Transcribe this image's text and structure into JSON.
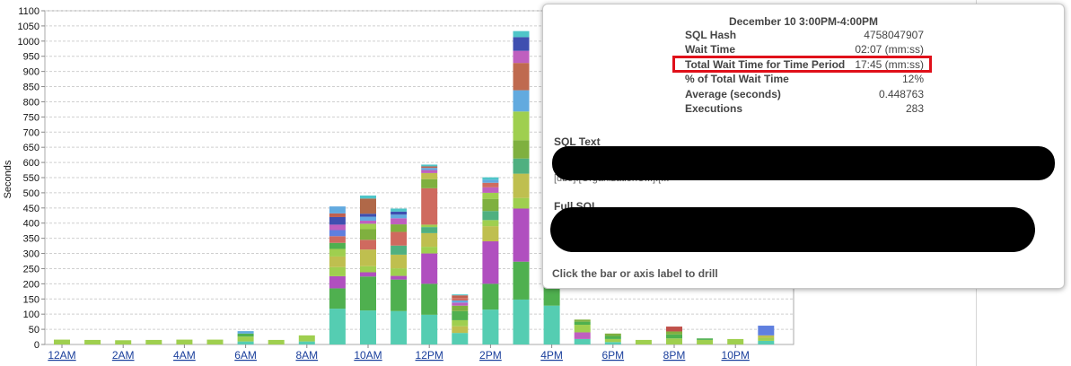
{
  "chart_data": {
    "type": "bar",
    "stacked": true,
    "ylabel": "Seconds",
    "xlabel": "",
    "ylim": [
      0,
      1100
    ],
    "ytick_values": [
      0,
      50,
      100,
      150,
      200,
      250,
      300,
      350,
      400,
      450,
      500,
      550,
      600,
      650,
      700,
      750,
      800,
      850,
      900,
      950,
      1000,
      1050,
      1100
    ],
    "grid": true,
    "categories": [
      "12AM",
      "1AM",
      "2AM",
      "3AM",
      "4AM",
      "5AM",
      "6AM",
      "7AM",
      "8AM",
      "9AM",
      "10AM",
      "11AM",
      "12PM",
      "1PM",
      "2PM",
      "3PM",
      "4PM",
      "5PM",
      "6PM",
      "7PM",
      "8PM",
      "9PM",
      "10PM",
      "11PM"
    ],
    "x_tick_labels": [
      {
        "index": 0,
        "label": "12AM"
      },
      {
        "index": 2,
        "label": "2AM"
      },
      {
        "index": 4,
        "label": "4AM"
      },
      {
        "index": 6,
        "label": "6AM"
      },
      {
        "index": 8,
        "label": "8AM"
      },
      {
        "index": 10,
        "label": "10AM"
      },
      {
        "index": 12,
        "label": "12PM"
      },
      {
        "index": 14,
        "label": "2PM"
      },
      {
        "index": 16,
        "label": "4PM"
      },
      {
        "index": 18,
        "label": "6PM"
      },
      {
        "index": 20,
        "label": "8PM"
      },
      {
        "index": 22,
        "label": "10PM"
      }
    ],
    "stacks": [
      [
        {
          "v": 16,
          "c": "#9fcf4f"
        }
      ],
      [
        {
          "v": 15,
          "c": "#9fcf4f"
        }
      ],
      [
        {
          "v": 14,
          "c": "#9fcf4f"
        }
      ],
      [
        {
          "v": 15,
          "c": "#9fcf4f"
        }
      ],
      [
        {
          "v": 16,
          "c": "#9fcf4f"
        }
      ],
      [
        {
          "v": 16,
          "c": "#9fcf4f"
        }
      ],
      [
        {
          "v": 10,
          "c": "#55cdb2"
        },
        {
          "v": 16,
          "c": "#9fcf4f"
        },
        {
          "v": 10,
          "c": "#4fb04f"
        },
        {
          "v": 8,
          "c": "#62aadf"
        }
      ],
      [
        {
          "v": 15,
          "c": "#9fcf4f"
        }
      ],
      [
        {
          "v": 10,
          "c": "#55cdb2"
        },
        {
          "v": 20,
          "c": "#9fcf4f"
        }
      ],
      [
        {
          "v": 118,
          "c": "#55cdb2"
        },
        {
          "v": 67,
          "c": "#4fb04f"
        },
        {
          "v": 40,
          "c": "#b04fbf"
        },
        {
          "v": 30,
          "c": "#9fcf4f"
        },
        {
          "v": 35,
          "c": "#bfbf4f"
        },
        {
          "v": 25,
          "c": "#9fcf4f"
        },
        {
          "v": 20,
          "c": "#4fb04f"
        },
        {
          "v": 22,
          "c": "#cf6a5f"
        },
        {
          "v": 20,
          "c": "#5f7fdf"
        },
        {
          "v": 18,
          "c": "#bf5fbf"
        },
        {
          "v": 25,
          "c": "#3f4fb0"
        },
        {
          "v": 12,
          "c": "#c06050"
        },
        {
          "v": 23,
          "c": "#62aadf"
        }
      ],
      [
        {
          "v": 112,
          "c": "#55cdb2"
        },
        {
          "v": 112,
          "c": "#4fb04f"
        },
        {
          "v": 14,
          "c": "#b04fbf"
        },
        {
          "v": 20,
          "c": "#9fcf4f"
        },
        {
          "v": 55,
          "c": "#bfbf4f"
        },
        {
          "v": 32,
          "c": "#cf6a5f"
        },
        {
          "v": 35,
          "c": "#7fb03f"
        },
        {
          "v": 18,
          "c": "#9fcf4f"
        },
        {
          "v": 10,
          "c": "#bf5fbf"
        },
        {
          "v": 13,
          "c": "#62aadf"
        },
        {
          "v": 10,
          "c": "#3f4fb0"
        },
        {
          "v": 50,
          "c": "#b06848"
        },
        {
          "v": 10,
          "c": "#4fc5c8"
        }
      ],
      [
        {
          "v": 110,
          "c": "#55cdb2"
        },
        {
          "v": 104,
          "c": "#4fb04f"
        },
        {
          "v": 12,
          "c": "#b04fbf"
        },
        {
          "v": 25,
          "c": "#9fcf4f"
        },
        {
          "v": 45,
          "c": "#bfbf4f"
        },
        {
          "v": 30,
          "c": "#4fb080"
        },
        {
          "v": 45,
          "c": "#cf6a5f"
        },
        {
          "v": 25,
          "c": "#7fb03f"
        },
        {
          "v": 20,
          "c": "#bf5fbf"
        },
        {
          "v": 12,
          "c": "#62aadf"
        },
        {
          "v": 10,
          "c": "#3f4fb0"
        },
        {
          "v": 10,
          "c": "#4fc5c8"
        }
      ],
      [
        {
          "v": 98,
          "c": "#55cdb2"
        },
        {
          "v": 102,
          "c": "#4fb04f"
        },
        {
          "v": 100,
          "c": "#b04fbf"
        },
        {
          "v": 22,
          "c": "#9fcf4f"
        },
        {
          "v": 45,
          "c": "#bfbf4f"
        },
        {
          "v": 20,
          "c": "#4fb080"
        },
        {
          "v": 8,
          "c": "#9fcf4f"
        },
        {
          "v": 120,
          "c": "#cf6a5f"
        },
        {
          "v": 30,
          "c": "#7fb03f"
        },
        {
          "v": 20,
          "c": "#bfbf4f"
        },
        {
          "v": 10,
          "c": "#bf5fbf"
        },
        {
          "v": 7,
          "c": "#62aadf"
        },
        {
          "v": 5,
          "c": "#c06050"
        },
        {
          "v": 6,
          "c": "#4fc5c8"
        }
      ],
      [
        {
          "v": 38,
          "c": "#55cdb2"
        },
        {
          "v": 22,
          "c": "#bfbf4f"
        },
        {
          "v": 20,
          "c": "#9fcf4f"
        },
        {
          "v": 30,
          "c": "#4fb04f"
        },
        {
          "v": 18,
          "c": "#7fb03f"
        },
        {
          "v": 10,
          "c": "#bf5fbf"
        },
        {
          "v": 7,
          "c": "#62aadf"
        },
        {
          "v": 8,
          "c": "#cf6a5f"
        },
        {
          "v": 9,
          "c": "#c06050"
        },
        {
          "v": 3,
          "c": "#4fc5c8"
        }
      ],
      [
        {
          "v": 115,
          "c": "#55cdb2"
        },
        {
          "v": 85,
          "c": "#4fb04f"
        },
        {
          "v": 140,
          "c": "#b04fbf"
        },
        {
          "v": 50,
          "c": "#bfbf4f"
        },
        {
          "v": 20,
          "c": "#9fcf4f"
        },
        {
          "v": 30,
          "c": "#4fb080"
        },
        {
          "v": 40,
          "c": "#7fb03f"
        },
        {
          "v": 20,
          "c": "#9fcf4f"
        },
        {
          "v": 18,
          "c": "#bf5fbf"
        },
        {
          "v": 15,
          "c": "#cf6a5f"
        },
        {
          "v": 10,
          "c": "#62aadf"
        },
        {
          "v": 8,
          "c": "#4fc5c8"
        }
      ],
      [
        {
          "v": 148,
          "c": "#55cdb2"
        },
        {
          "v": 125,
          "c": "#4fb04f"
        },
        {
          "v": 175,
          "c": "#b04fbf"
        },
        {
          "v": 35,
          "c": "#9fcf4f"
        },
        {
          "v": 80,
          "c": "#bfbf4f"
        },
        {
          "v": 50,
          "c": "#4fb080"
        },
        {
          "v": 60,
          "c": "#7fb03f"
        },
        {
          "v": 95,
          "c": "#9fcf4f"
        },
        {
          "v": 70,
          "c": "#62aadf"
        },
        {
          "v": 90,
          "c": "#bf6a4f"
        },
        {
          "v": 40,
          "c": "#bf5fbf"
        },
        {
          "v": 45,
          "c": "#3f4fb0"
        },
        {
          "v": 20,
          "c": "#4fc5c8"
        }
      ],
      [
        {
          "v": 128,
          "c": "#55cdb2"
        },
        {
          "v": 80,
          "c": "#4fb04f"
        }
      ],
      [
        {
          "v": 18,
          "c": "#55cdb2"
        },
        {
          "v": 22,
          "c": "#bf5fbf"
        },
        {
          "v": 25,
          "c": "#9fcf4f"
        },
        {
          "v": 10,
          "c": "#4fb04f"
        },
        {
          "v": 7,
          "c": "#7fb03f"
        }
      ],
      [
        {
          "v": 8,
          "c": "#55cdb2"
        },
        {
          "v": 10,
          "c": "#9fcf4f"
        },
        {
          "v": 10,
          "c": "#4fb04f"
        },
        {
          "v": 8,
          "c": "#7fb03f"
        }
      ],
      [
        {
          "v": 15,
          "c": "#9fcf4f"
        }
      ],
      [
        {
          "v": 20,
          "c": "#9fcf4f"
        },
        {
          "v": 13,
          "c": "#4fb04f"
        },
        {
          "v": 10,
          "c": "#7fb03f"
        },
        {
          "v": 16,
          "c": "#c0504a"
        }
      ],
      [
        {
          "v": 15,
          "c": "#9fcf4f"
        },
        {
          "v": 5,
          "c": "#4fb04f"
        }
      ],
      [
        {
          "v": 18,
          "c": "#9fcf4f"
        }
      ],
      [
        {
          "v": 12,
          "c": "#55cdb2"
        },
        {
          "v": 10,
          "c": "#9fcf4f"
        },
        {
          "v": 8,
          "c": "#bfbf4f"
        },
        {
          "v": 32,
          "c": "#5f7fdf"
        }
      ]
    ]
  },
  "tooltip": {
    "title": "December 10 3:00PM-4:00PM",
    "rows": [
      {
        "label": "SQL Hash",
        "value": "4758047907"
      },
      {
        "label": "Wait Time",
        "value": "02:07 (mm:ss)"
      },
      {
        "label": "Total Wait Time for Time Period",
        "value": "17:45 (mm:ss)"
      },
      {
        "label": "% of Total Wait Time",
        "value": "12%"
      },
      {
        "label": "Average (seconds)",
        "value": "0.448763"
      },
      {
        "label": "Executions",
        "value": "283"
      }
    ],
    "sql_text_label": "SQL Text",
    "sql_text_fragment": "[dbo].[OrganizationU...].[...",
    "full_sql_label": "Full SQL",
    "drill_hint": "Click the bar or axis label to drill"
  }
}
